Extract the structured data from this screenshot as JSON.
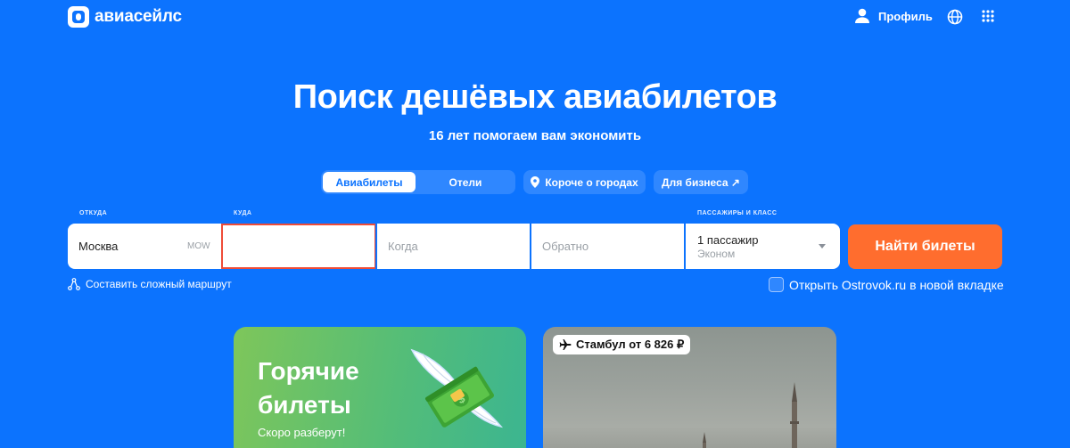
{
  "header": {
    "logo_text": "авиасейлс",
    "profile_label": "Профиль"
  },
  "hero": {
    "title": "Поиск дешёвых авиабилетов",
    "subtitle": "16 лет помогаем вам экономить"
  },
  "tabs": {
    "flights": "Авиабилеты",
    "hotels": "Отели",
    "cities": "Короче о городах",
    "business": "Для бизнеса ↗"
  },
  "search": {
    "origin_label": "ОТКУДА",
    "origin_value": "Москва",
    "origin_code": "MOW",
    "destination_label": "КУДА",
    "destination_value": "",
    "depart_placeholder": "Когда",
    "return_placeholder": "Обратно",
    "passengers_label": "ПАССАЖИРЫ И КЛАСС",
    "passengers_value": "1 пассажир",
    "class_value": "Эконом",
    "submit_label": "Найти билеты"
  },
  "options": {
    "complex_route": "Составить сложный маршрут",
    "ostrovok": "Открыть Ostrovok.ru в новой вкладке"
  },
  "cards": {
    "hot_title_line1": "Горячие",
    "hot_title_line2": "билеты",
    "hot_subtitle": "Скоро разберут!",
    "istanbul_tag": "Стамбул от 6 826 ₽"
  },
  "colors": {
    "background": "#0c73fe",
    "primary_button": "#ff6d2e",
    "focus_border": "#ee4c38"
  }
}
